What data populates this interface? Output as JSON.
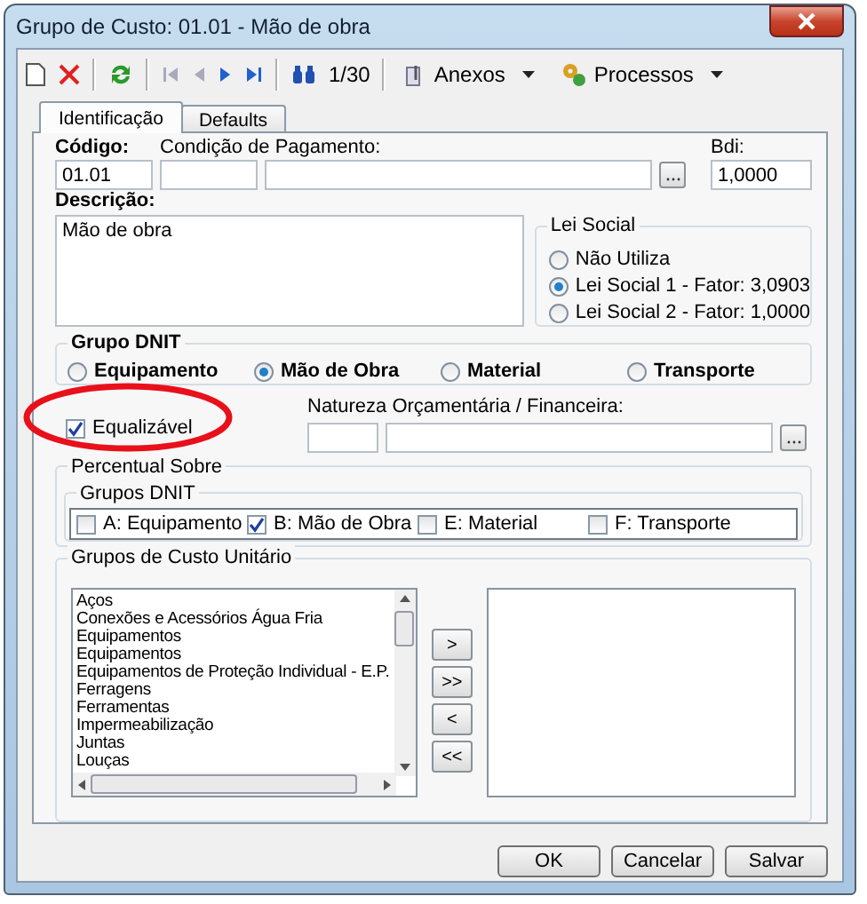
{
  "window": {
    "title": "Grupo de Custo: 01.01 - Mão de obra"
  },
  "toolbar": {
    "record_counter": "1/30",
    "menus": [
      "Anexos",
      "Processos"
    ]
  },
  "tabs": [
    {
      "label": "Identificação",
      "selected": true
    },
    {
      "label": "Defaults",
      "selected": false
    }
  ],
  "codigo": {
    "label": "Código:",
    "value": "01.01"
  },
  "condicao_pagamento": {
    "label": "Condição de Pagamento:"
  },
  "bdi": {
    "label": "Bdi:",
    "value": "1,0000"
  },
  "descricao": {
    "label": "Descrição:",
    "value": "Mão de obra"
  },
  "lei_social": {
    "title": "Lei Social",
    "options": [
      {
        "label": "Não Utiliza",
        "selected": false
      },
      {
        "label": "Lei Social 1 - Fator: 3,0903",
        "selected": true
      },
      {
        "label": "Lei Social 2 - Fator: 1,0000",
        "selected": false
      }
    ]
  },
  "grupo_dnit": {
    "title": "Grupo DNIT",
    "options": [
      {
        "label": "Equipamento",
        "selected": false
      },
      {
        "label": "Mão de Obra",
        "selected": true
      },
      {
        "label": "Material",
        "selected": false
      },
      {
        "label": "Transporte",
        "selected": false
      }
    ]
  },
  "equalizavel": {
    "label": "Equalizável",
    "checked": true
  },
  "natureza": {
    "label": "Natureza Orçamentária / Financeira:"
  },
  "percentual_sobre": {
    "title": "Percentual Sobre",
    "grupos_dnit": {
      "title": "Grupos DNIT",
      "options": [
        {
          "label": "A: Equipamento",
          "checked": false
        },
        {
          "label": "B: Mão de Obra",
          "checked": true
        },
        {
          "label": "E: Material",
          "checked": false
        },
        {
          "label": "F: Transporte",
          "checked": false
        }
      ]
    }
  },
  "grupos_custo_unitario": {
    "title": "Grupos de Custo Unitário",
    "available": [
      "Aços",
      "Conexões e Acessórios Água Fria",
      "Equipamentos",
      "Equipamentos",
      "Equipamentos de Proteção Individual - E.P.",
      "Ferragens",
      "Ferramentas",
      "Impermeabilização",
      "Juntas",
      "Louças"
    ],
    "transfer_buttons": [
      ">",
      ">>",
      "<",
      "<<"
    ]
  },
  "buttons": [
    "OK",
    "Cancelar",
    "Salvar"
  ]
}
